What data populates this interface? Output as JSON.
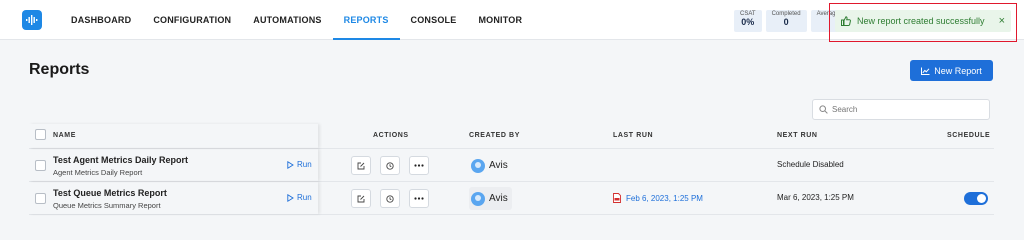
{
  "nav": {
    "items": [
      {
        "label": "DASHBOARD",
        "active": false
      },
      {
        "label": "CONFIGURATION",
        "active": false
      },
      {
        "label": "AUTOMATIONS",
        "active": false
      },
      {
        "label": "REPORTS",
        "active": true
      },
      {
        "label": "CONSOLE",
        "active": false
      },
      {
        "label": "MONITOR",
        "active": false
      }
    ]
  },
  "stats": [
    {
      "label": "CSAT",
      "value": "0%"
    },
    {
      "label": "Completed",
      "value": "0"
    },
    {
      "label": "Averag",
      "value": ""
    }
  ],
  "toast": {
    "message": "New report created successfully",
    "close": "×"
  },
  "page": {
    "title": "Reports",
    "new_report_label": "New Report"
  },
  "search": {
    "placeholder": "Search"
  },
  "table": {
    "headers": {
      "name": "NAME",
      "actions": "ACTIONS",
      "created_by": "CREATED BY",
      "last_run": "LAST RUN",
      "next_run": "NEXT RUN",
      "schedule": "SCHEDULE"
    },
    "rows": [
      {
        "name": "Test Agent Metrics Daily Report",
        "subtitle": "Agent Metrics Daily Report",
        "run_label": "Run",
        "created_by": "Avis",
        "last_run": "",
        "next_run": "Schedule Disabled",
        "schedule_enabled": false
      },
      {
        "name": "Test Queue Metrics Report",
        "subtitle": "Queue Metrics Summary Report",
        "run_label": "Run",
        "created_by": "Avis",
        "last_run": "Feb 6, 2023, 1:25 PM",
        "next_run": "Mar 6, 2023, 1:25 PM",
        "schedule_enabled": true
      }
    ]
  },
  "colors": {
    "accent": "#1e6fd9",
    "toast_bg": "#e9f5ea",
    "toast_text": "#2e7d32",
    "highlight": "#e0182d"
  }
}
